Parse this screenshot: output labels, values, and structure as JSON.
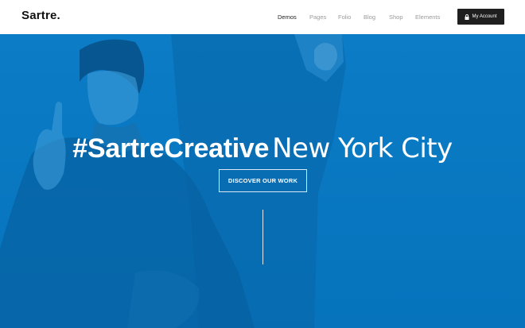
{
  "brand": {
    "logo": "Sartre."
  },
  "nav": {
    "items": [
      {
        "label": "Demos",
        "active": true
      },
      {
        "label": "Pages",
        "active": false
      },
      {
        "label": "Folio",
        "active": false
      },
      {
        "label": "Blog",
        "active": false
      },
      {
        "label": "Shop",
        "active": false
      },
      {
        "label": "Elements",
        "active": false
      }
    ],
    "account_label": "My Account",
    "account_icon": "lock-icon"
  },
  "hero": {
    "headline_strong": "#SartreCreative",
    "headline_light": "New York City",
    "cta_label": "DISCOVER OUR WORK",
    "overlay_color": "#0a78c2"
  }
}
